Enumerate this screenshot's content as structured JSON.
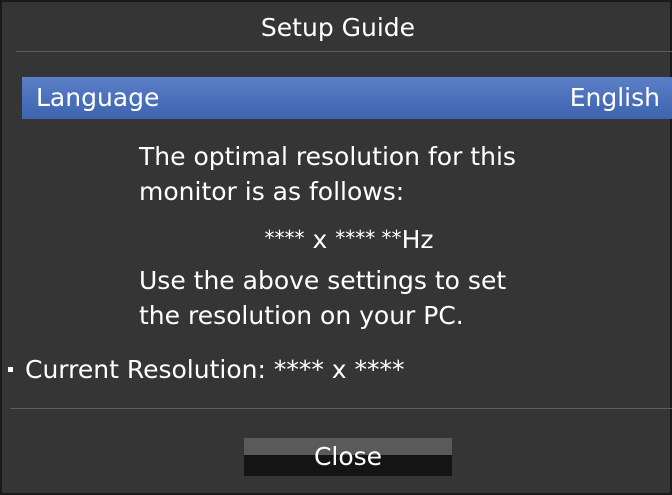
{
  "dialog": {
    "title": "Setup Guide",
    "language_label": "Language",
    "language_value": "English",
    "message_line1": "The optimal resolution for this",
    "message_line2": "monitor is as follows:",
    "optimal_resolution": {
      "w": "****",
      "sep1": " x ",
      "h": "****",
      "hz_stars": " **",
      "hz_unit": "Hz"
    },
    "instruction_line1": "Use the above settings to set",
    "instruction_line2": "the resolution on your PC.",
    "current_resolution": "Current Resolution: **** x ****",
    "close_label": "Close"
  },
  "colors": {
    "panel_bg": "#353535",
    "highlight": "#4a70bb",
    "text": "#ffffff"
  }
}
